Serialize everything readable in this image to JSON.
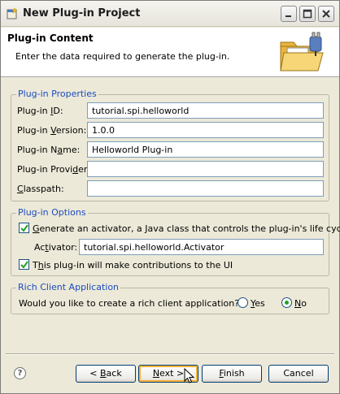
{
  "window": {
    "title": "New Plug-in Project",
    "icons": {
      "app": "eclipse-new-project-icon",
      "minimize": "minimize-icon",
      "maximize": "maximize-icon",
      "close": "close-icon"
    }
  },
  "banner": {
    "title": "Plug-in Content",
    "description": "Enter the data required to generate the plug-in.",
    "art": "plugin-folder-wizard-icon"
  },
  "properties": {
    "group_label": "Plug-in Properties",
    "id": {
      "label_pre": "Plug-in ",
      "label_mn": "I",
      "label_post": "D:",
      "value": "tutorial.spi.helloworld"
    },
    "version": {
      "label_pre": "Plug-in ",
      "label_mn": "V",
      "label_post": "ersion:",
      "value": "1.0.0"
    },
    "name": {
      "label_pre": "Plug-in N",
      "label_mn": "a",
      "label_post": "me:",
      "value": "Helloworld Plug-in"
    },
    "provider": {
      "label_pre": "Plug-in Provi",
      "label_mn": "d",
      "label_post": "er:",
      "value": ""
    },
    "classpath": {
      "label_pre": "",
      "label_mn": "C",
      "label_post": "lasspath:",
      "value": ""
    }
  },
  "options": {
    "group_label": "Plug-in Options",
    "activator_check": {
      "label_pre": "",
      "label_mn": "G",
      "label_post": "enerate an activator, a Java class that controls the plug-in's life cycle",
      "checked": true
    },
    "activator": {
      "label_pre": "Ac",
      "label_mn": "t",
      "label_post": "ivator:",
      "value": "tutorial.spi.helloworld.Activator"
    },
    "ui_check": {
      "label_pre": "T",
      "label_mn": "h",
      "label_post": "is plug-in will make contributions to the UI",
      "checked": true
    }
  },
  "rcp": {
    "group_label": "Rich Client Application",
    "question": "Would you like to create a rich client application?",
    "yes": {
      "label_pre": "",
      "label_mn": "Y",
      "label_post": "es",
      "selected": false
    },
    "no": {
      "label_pre": "",
      "label_mn": "N",
      "label_post": "o",
      "selected": true
    }
  },
  "buttons": {
    "help": "?",
    "back": {
      "label_pre": "< ",
      "label_mn": "B",
      "label_post": "ack"
    },
    "next": {
      "label_pre": "",
      "label_mn": "N",
      "label_post": "ext >"
    },
    "finish": {
      "label_pre": "",
      "label_mn": "F",
      "label_post": "inish"
    },
    "cancel": {
      "label": "Cancel"
    }
  },
  "colors": {
    "accent": "#1a4bbf",
    "window_bg": "#ece9d8",
    "check": "#21a121",
    "default_button_highlight": "#f8b33a"
  }
}
